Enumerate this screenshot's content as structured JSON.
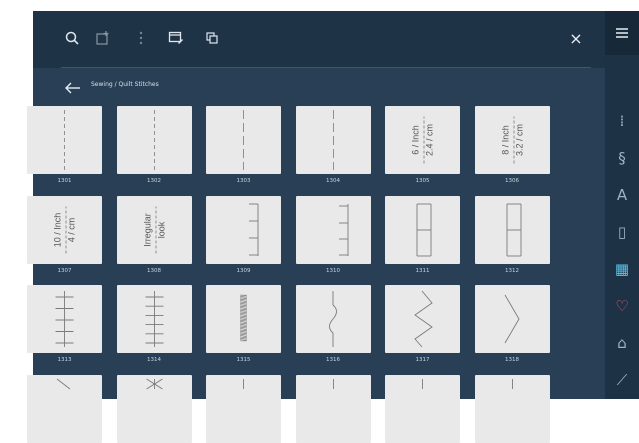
{
  "toolbar": {
    "icons": [
      "search-icon",
      "add-stitch-icon",
      "more-vertical-icon",
      "edit-window-icon",
      "copy-icon"
    ],
    "close_icon": "×"
  },
  "breadcrumb": {
    "back_icon": "arrow-left-icon",
    "text": "Sewing / Quilt Stitches"
  },
  "stitches": [
    {
      "id": "1301",
      "pattern": "dash-line"
    },
    {
      "id": "1302",
      "pattern": "dash-line"
    },
    {
      "id": "1303",
      "pattern": "long-dash-line"
    },
    {
      "id": "1304",
      "pattern": "long-dash-line"
    },
    {
      "id": "1305",
      "pattern": "text",
      "text_a": "6 / Inch",
      "text_b": "2.4 / cm"
    },
    {
      "id": "1306",
      "pattern": "text",
      "text_a": "8 / Inch",
      "text_b": "3.2 / cm"
    },
    {
      "id": "1307",
      "pattern": "text",
      "text_a": "10 / Inch",
      "text_b": "4 / cm"
    },
    {
      "id": "1308",
      "pattern": "text",
      "text_a": "Irregular",
      "text_b": "look"
    },
    {
      "id": "1309",
      "pattern": "blanket-small-dense"
    },
    {
      "id": "1310",
      "pattern": "blanket-small"
    },
    {
      "id": "1311",
      "pattern": "blanket-large-dense"
    },
    {
      "id": "1312",
      "pattern": "blanket-large"
    },
    {
      "id": "1313",
      "pattern": "feather-cross"
    },
    {
      "id": "1314",
      "pattern": "feather-cross-dense"
    },
    {
      "id": "1315",
      "pattern": "satin"
    },
    {
      "id": "1316",
      "pattern": "wave-small"
    },
    {
      "id": "1317",
      "pattern": "zigzag"
    },
    {
      "id": "1318",
      "pattern": "wave-large"
    },
    {
      "id": "",
      "pattern": "partial-diagonal"
    },
    {
      "id": "",
      "pattern": "partial-star"
    },
    {
      "id": "",
      "pattern": "partial-line"
    },
    {
      "id": "",
      "pattern": "partial-line"
    },
    {
      "id": "",
      "pattern": "partial-line"
    },
    {
      "id": "",
      "pattern": "partial-line"
    }
  ],
  "sidebar": {
    "menu_icon": "hamburger-menu-icon",
    "items": [
      {
        "name": "straight-stitch-icon",
        "glyph": "⁞",
        "state": "normal"
      },
      {
        "name": "decorative-stitch-icon",
        "glyph": "§",
        "state": "normal"
      },
      {
        "name": "alphabet-icon",
        "glyph": "A",
        "state": "normal"
      },
      {
        "name": "buttonhole-icon",
        "glyph": "▯",
        "state": "normal"
      },
      {
        "name": "quilt-stitch-icon",
        "glyph": "▦",
        "state": "active"
      },
      {
        "name": "favorites-heart-icon",
        "glyph": "♡",
        "state": "fav"
      },
      {
        "name": "bobbin-icon",
        "glyph": "⌂",
        "state": "normal"
      },
      {
        "name": "needle-icon",
        "glyph": "⟋",
        "state": "normal"
      }
    ]
  },
  "colors": {
    "panel": "#283f56",
    "topbar": "#1f3347",
    "sidebar": "#1e3246",
    "active": "#5cc3e8",
    "favorite": "#e0566d",
    "tile": "#e9e9e9"
  }
}
